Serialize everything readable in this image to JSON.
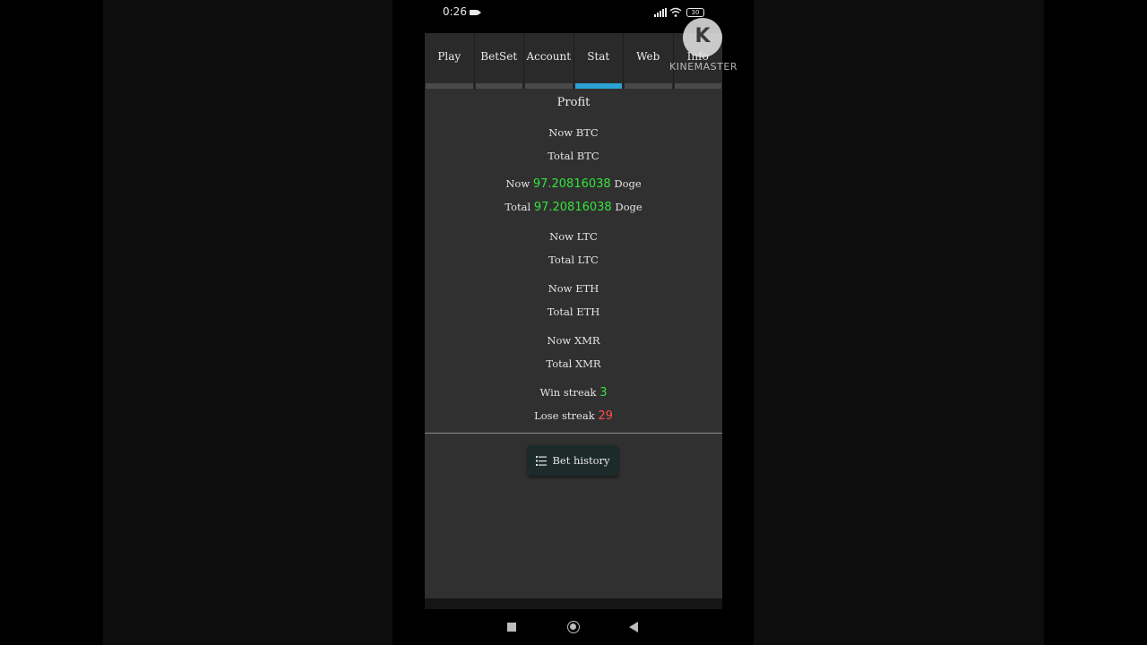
{
  "status_bar": {
    "time": "0:26",
    "battery": "30",
    "icons": [
      "video-camera-icon",
      "signal-icon",
      "wifi-icon",
      "battery-icon"
    ]
  },
  "tabs": [
    {
      "label": "Play",
      "active": false
    },
    {
      "label": "BetSet",
      "active": false
    },
    {
      "label": "Account",
      "active": false
    },
    {
      "label": "Stat",
      "active": true
    },
    {
      "label": "Web",
      "active": false
    },
    {
      "label": "Info",
      "active": false
    }
  ],
  "stats": {
    "title": "Profit",
    "btc": {
      "now_label": "Now",
      "total_label": "Total",
      "now_value": "",
      "total_value": "",
      "unit": "BTC"
    },
    "doge": {
      "now_label": "Now",
      "total_label": "Total",
      "now_value": "97.20816038",
      "total_value": "97.20816038",
      "unit": "Doge"
    },
    "ltc": {
      "now_label": "Now",
      "total_label": "Total",
      "now_value": "",
      "total_value": "",
      "unit": "LTC"
    },
    "eth": {
      "now_label": "Now",
      "total_label": "Total",
      "now_value": "",
      "total_value": "",
      "unit": "ETH"
    },
    "xmr": {
      "now_label": "Now",
      "total_label": "Total",
      "now_value": "",
      "total_value": "",
      "unit": "XMR"
    },
    "win_streak_label": "Win streak",
    "win_streak_value": "3",
    "lose_streak_label": "Lose streak",
    "lose_streak_value": "29"
  },
  "bet_history_button": "Bet history",
  "watermark": {
    "letter": "K",
    "text": "KINEMASTER"
  },
  "colors": {
    "accent": "#2aa3d6",
    "positive": "#34e33d",
    "negative": "#ff4d4d",
    "background": "#303030"
  }
}
